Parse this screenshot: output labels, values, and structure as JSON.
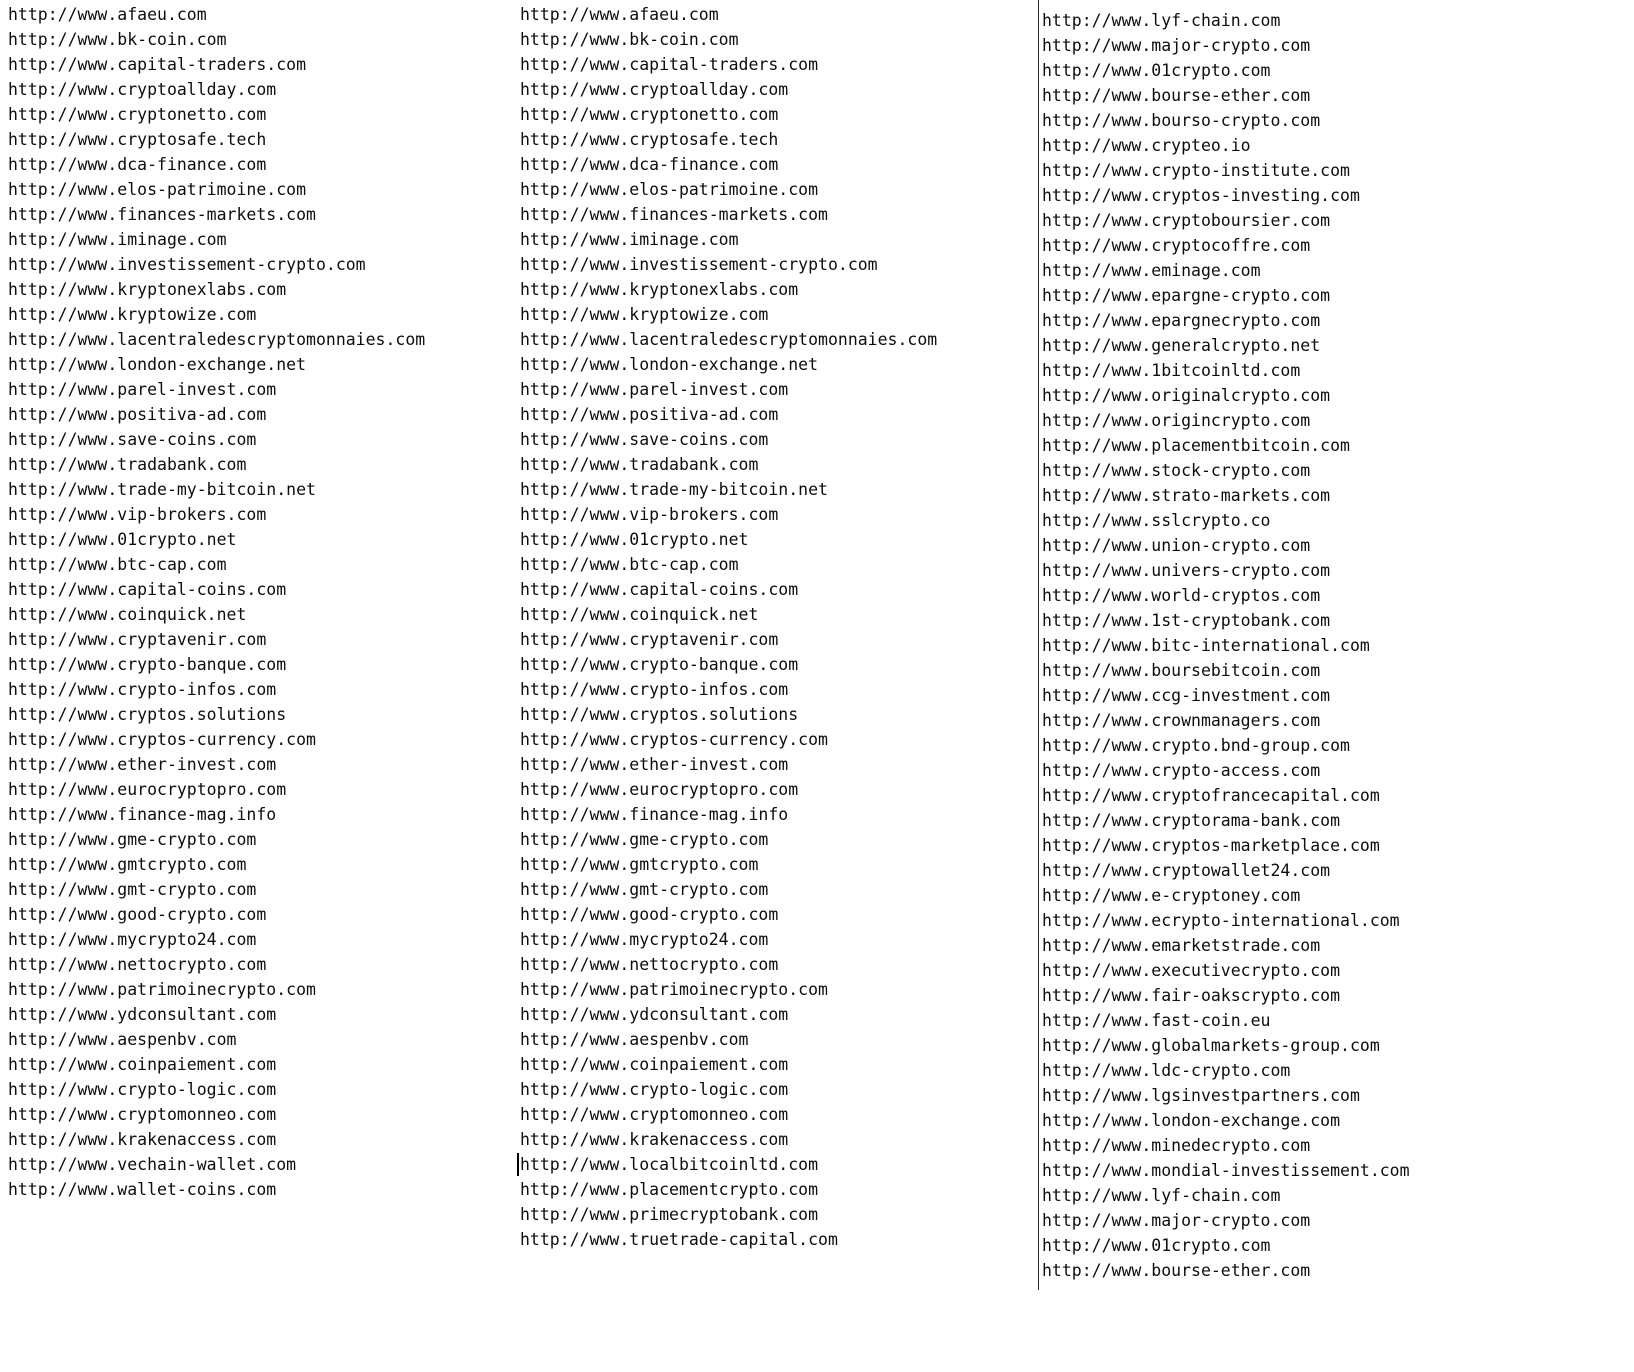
{
  "document": {
    "type": "plain-text-url-list",
    "background_color": "#ffffff",
    "text_color": "#0d0d0d",
    "columns": [
      {
        "id": "column-1",
        "caret_index": null,
        "lines": [
          "http://www.afaeu.com",
          "http://www.bk-coin.com",
          "http://www.capital-traders.com",
          "http://www.cryptoallday.com",
          "http://www.cryptonetto.com",
          "http://www.cryptosafe.tech",
          "http://www.dca-finance.com",
          "http://www.elos-patrimoine.com",
          "http://www.finances-markets.com",
          "http://www.iminage.com",
          "http://www.investissement-crypto.com",
          "http://www.kryptonexlabs.com",
          "http://www.kryptowize.com",
          "http://www.lacentraledescryptomonnaies.com",
          "http://www.london-exchange.net",
          "http://www.parel-invest.com",
          "http://www.positiva-ad.com",
          "http://www.save-coins.com",
          "http://www.tradabank.com",
          "http://www.trade-my-bitcoin.net",
          "http://www.vip-brokers.com",
          "http://www.01crypto.net",
          "http://www.btc-cap.com",
          "http://www.capital-coins.com",
          "http://www.coinquick.net",
          "http://www.cryptavenir.com",
          "http://www.crypto-banque.com",
          "http://www.crypto-infos.com",
          "http://www.cryptos.solutions",
          "http://www.cryptos-currency.com",
          "http://www.ether-invest.com",
          "http://www.eurocryptopro.com",
          "http://www.finance-mag.info",
          "http://www.gme-crypto.com",
          "http://www.gmtcrypto.com",
          "http://www.gmt-crypto.com",
          "http://www.good-crypto.com",
          "http://www.mycrypto24.com",
          "http://www.nettocrypto.com",
          "http://www.patrimoinecrypto.com",
          "http://www.ydconsultant.com",
          "http://www.aespenbv.com",
          "http://www.coinpaiement.com",
          "http://www.crypto-logic.com",
          "http://www.cryptomonneo.com",
          "http://www.krakenaccess.com",
          "http://www.vechain-wallet.com",
          "http://www.wallet-coins.com"
        ]
      },
      {
        "id": "column-2",
        "caret_index": 46,
        "lines": [
          "http://www.afaeu.com",
          "http://www.bk-coin.com",
          "http://www.capital-traders.com",
          "http://www.cryptoallday.com",
          "http://www.cryptonetto.com",
          "http://www.cryptosafe.tech",
          "http://www.dca-finance.com",
          "http://www.elos-patrimoine.com",
          "http://www.finances-markets.com",
          "http://www.iminage.com",
          "http://www.investissement-crypto.com",
          "http://www.kryptonexlabs.com",
          "http://www.kryptowize.com",
          "http://www.lacentraledescryptomonnaies.com",
          "http://www.london-exchange.net",
          "http://www.parel-invest.com",
          "http://www.positiva-ad.com",
          "http://www.save-coins.com",
          "http://www.tradabank.com",
          "http://www.trade-my-bitcoin.net",
          "http://www.vip-brokers.com",
          "http://www.01crypto.net",
          "http://www.btc-cap.com",
          "http://www.capital-coins.com",
          "http://www.coinquick.net",
          "http://www.cryptavenir.com",
          "http://www.crypto-banque.com",
          "http://www.crypto-infos.com",
          "http://www.cryptos.solutions",
          "http://www.cryptos-currency.com",
          "http://www.ether-invest.com",
          "http://www.eurocryptopro.com",
          "http://www.finance-mag.info",
          "http://www.gme-crypto.com",
          "http://www.gmtcrypto.com",
          "http://www.gmt-crypto.com",
          "http://www.good-crypto.com",
          "http://www.mycrypto24.com",
          "http://www.nettocrypto.com",
          "http://www.patrimoinecrypto.com",
          "http://www.ydconsultant.com",
          "http://www.aespenbv.com",
          "http://www.coinpaiement.com",
          "http://www.crypto-logic.com",
          "http://www.cryptomonneo.com",
          "http://www.krakenaccess.com",
          "http://www.localbitcoinltd.com",
          "http://www.placementcrypto.com",
          "http://www.primecryptobank.com",
          "http://www.truetrade-capital.com"
        ]
      },
      {
        "id": "column-3",
        "caret_index": null,
        "lines": [
          "http://www.lyf-chain.com",
          "http://www.major-crypto.com",
          "http://www.01crypto.com",
          "http://www.bourse-ether.com",
          "http://www.bourso-crypto.com",
          "http://www.crypteo.io",
          "http://www.crypto-institute.com",
          "http://www.cryptos-investing.com",
          "http://www.cryptoboursier.com",
          "http://www.cryptocoffre.com",
          "http://www.eminage.com",
          "http://www.epargne-crypto.com",
          "http://www.epargnecrypto.com",
          "http://www.generalcrypto.net",
          "http://www.1bitcoinltd.com",
          "http://www.originalcrypto.com",
          "http://www.origincrypto.com",
          "http://www.placementbitcoin.com",
          "http://www.stock-crypto.com",
          "http://www.strato-markets.com",
          "http://www.sslcrypto.co",
          "http://www.union-crypto.com",
          "http://www.univers-crypto.com",
          "http://www.world-cryptos.com",
          "http://www.1st-cryptobank.com",
          "http://www.bitc-international.com",
          "http://www.boursebitcoin.com",
          "http://www.ccg-investment.com",
          "http://www.crownmanagers.com",
          "http://www.crypto.bnd-group.com",
          "http://www.crypto-access.com",
          "http://www.cryptofrancecapital.com",
          "http://www.cryptorama-bank.com",
          "http://www.cryptos-marketplace.com",
          "http://www.cryptowallet24.com",
          "http://www.e-cryptoney.com",
          "http://www.ecrypto-international.com",
          "http://www.emarketstrade.com",
          "http://www.executivecrypto.com",
          "http://www.fair-oakscrypto.com",
          "http://www.fast-coin.eu",
          "http://www.globalmarkets-group.com",
          "http://www.ldc-crypto.com",
          "http://www.lgsinvestpartners.com",
          "http://www.london-exchange.com",
          "http://www.minedecrypto.com",
          "http://www.mondial-investissement.com",
          "http://www.lyf-chain.com",
          "http://www.major-crypto.com",
          "http://www.01crypto.com",
          "http://www.bourse-ether.com"
        ]
      }
    ]
  }
}
